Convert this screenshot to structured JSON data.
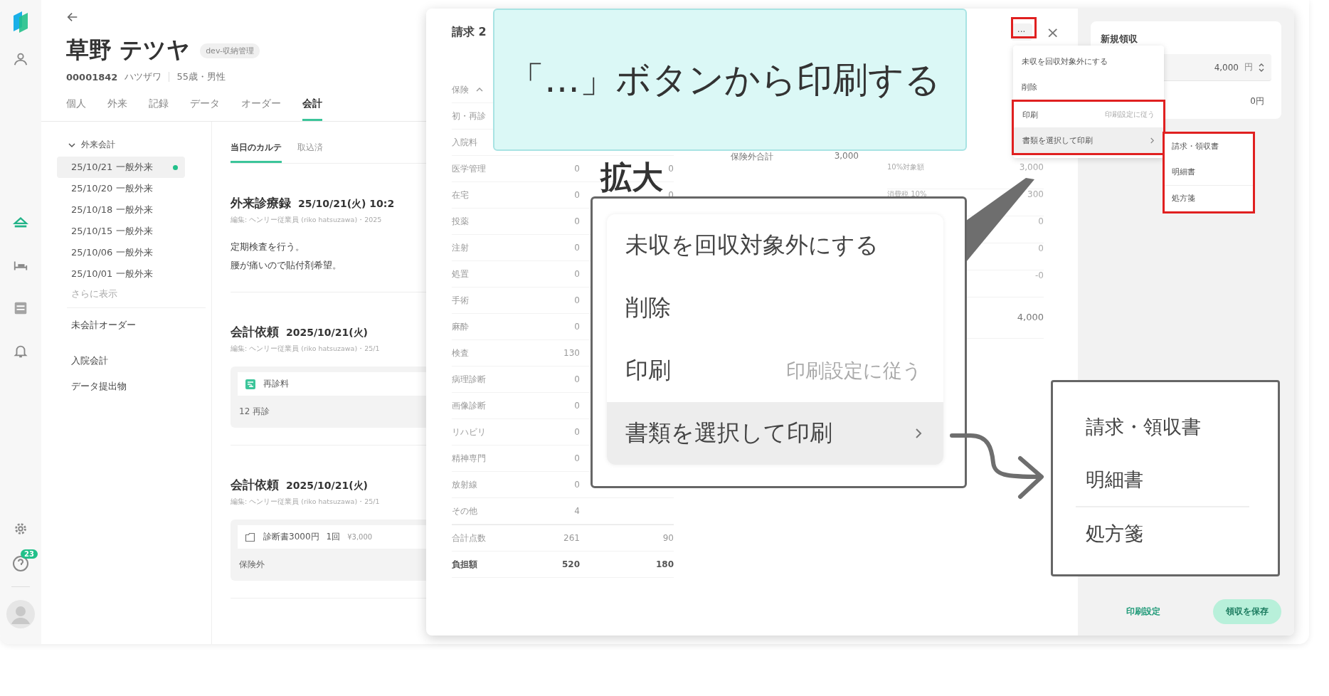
{
  "rail": {
    "nav": [
      {
        "kind": "person",
        "selected": false
      },
      {
        "kind": "home",
        "selected": true
      },
      {
        "kind": "bed",
        "selected": false
      },
      {
        "kind": "list",
        "selected": false
      },
      {
        "kind": "bell",
        "selected": false
      }
    ],
    "help_badge": "23"
  },
  "patient": {
    "name": "草野 テツヤ",
    "badge": "dev-収納管理",
    "id": "00001842",
    "kana": "ハツザワ",
    "age_sex": "55歳・男性"
  },
  "tabs": [
    {
      "label": "個人",
      "selected": false
    },
    {
      "label": "外来",
      "selected": false
    },
    {
      "label": "記録",
      "selected": false
    },
    {
      "label": "データ",
      "selected": false
    },
    {
      "label": "オーダー",
      "selected": false
    },
    {
      "label": "会計",
      "selected": true
    }
  ],
  "ledger": {
    "group": {
      "label": "外来会計",
      "expanded": true,
      "items": [
        {
          "label": "25/10/21 一般外来",
          "selected": true,
          "dot": true
        },
        {
          "label": "25/10/20 一般外来",
          "selected": false,
          "dot": false
        },
        {
          "label": "25/10/18 一般外来",
          "selected": false,
          "dot": false
        },
        {
          "label": "25/10/15 一般外来",
          "selected": false,
          "dot": false
        },
        {
          "label": "25/10/06 一般外来",
          "selected": false,
          "dot": false
        },
        {
          "label": "25/10/01 一般外来",
          "selected": false,
          "dot": false
        }
      ],
      "more": "さらに表示"
    },
    "sections": [
      "未会計オーダー",
      "入院会計",
      "データ提出物"
    ]
  },
  "record": {
    "tabs": [
      {
        "label": "当日のカルテ",
        "selected": true
      },
      {
        "label": "取込済",
        "selected": false
      }
    ],
    "entries": [
      {
        "kind": "note",
        "title": "外来診療録",
        "date": "25/10/21(火) 10:2",
        "meta": "編集: ヘンリー従業員 (riko hatsuzawa)・2025",
        "lines": [
          "定期検査を行う。",
          "腰が痛いので貼付剤希望。"
        ]
      },
      {
        "kind": "billing",
        "title": "会計依頼",
        "date": "2025/10/21(火)",
        "meta": "編集: ヘンリー従業員 (riko hatsuzawa)・25/1",
        "item": {
          "kind": "insured",
          "name": "再診料",
          "detail": "12 再診"
        }
      },
      {
        "kind": "billing",
        "title": "会計依頼",
        "date": "2025/10/21(火)",
        "meta": "編集: ヘンリー従業員 (riko hatsuzawa)・25/1",
        "item": {
          "kind": "self_pay",
          "name": "診断書3000円",
          "qty": "1回",
          "price": "¥3,000",
          "detail": "保険外"
        }
      }
    ]
  },
  "dialog": {
    "title": "請求 2",
    "more_button": "···",
    "close": "×",
    "rows": [
      {
        "kind": "header",
        "label": "保険"
      },
      {
        "label": "初・再診"
      },
      {
        "label": "入院料"
      },
      {
        "label": "医学管理",
        "col1": "0",
        "col2": "0"
      },
      {
        "label": "在宅",
        "col1": "0",
        "col2": "0"
      },
      {
        "label": "投薬",
        "col1": "0"
      },
      {
        "label": "注射",
        "col1": "0"
      },
      {
        "label": "処置",
        "col1": "0"
      },
      {
        "label": "手術",
        "col1": "0"
      },
      {
        "label": "麻酔",
        "col1": "0"
      },
      {
        "label": "検査",
        "col1": "130"
      },
      {
        "label": "病理診断",
        "col1": "0"
      },
      {
        "label": "画像診断",
        "col1": "0"
      },
      {
        "label": "リハビリ",
        "col1": "0"
      },
      {
        "label": "精神専門",
        "col1": "0"
      },
      {
        "label": "放射線",
        "col1": "0"
      },
      {
        "label": "その他",
        "col1": "4"
      },
      {
        "kind": "total",
        "label": "合計点数",
        "col1": "261",
        "col2": "90"
      },
      {
        "kind": "strong",
        "label": "負担額",
        "col1": "520",
        "col2": "180"
      }
    ],
    "self_pay": {
      "label": "保険外合計",
      "value": "3,000"
    },
    "summary": [
      {
        "label": "10%対象額",
        "value": "3,000"
      },
      {
        "label": "消費税 10%",
        "value": "300"
      },
      {
        "value": "0"
      },
      {
        "value": "0"
      },
      {
        "value": "-0"
      },
      {
        "value": "4,000"
      }
    ],
    "receipt": {
      "title": "新規領収",
      "amount": "4,000",
      "unit": "円",
      "balance": "0円",
      "print_settings": "印刷設定",
      "save": "領収を保存"
    }
  },
  "menu": {
    "items": [
      {
        "label": "未収を回収対象外にする",
        "annotated": false
      },
      {
        "label": "削除",
        "annotated": false
      },
      {
        "label": "印刷",
        "hint": "印刷設定に従う",
        "annotated": true
      },
      {
        "label": "書類を選択して印刷",
        "submenu": true,
        "highlighted": true,
        "annotated": true
      }
    ],
    "submenu": {
      "annotated": true,
      "items": [
        {
          "label": "請求・領収書",
          "separated": false
        },
        {
          "label": "明細書",
          "separated": false
        },
        {
          "label": "処方箋",
          "separated": true
        }
      ]
    }
  },
  "callout": {
    "text": "「…」ボタンから印刷する",
    "zoom_label": "拡大"
  },
  "zoom_menu": [
    {
      "label": "未収を回収対象外にする"
    },
    {
      "label": "削除"
    },
    {
      "label": "印刷",
      "hint": "印刷設定に従う"
    },
    {
      "label": "書類を選択して印刷",
      "submenu": true,
      "highlighted": true
    }
  ],
  "zoom_submenu": [
    {
      "label": "請求・領収書",
      "separated": false
    },
    {
      "label": "明細書",
      "separated": false
    },
    {
      "label": "処方箋",
      "separated": true
    }
  ]
}
